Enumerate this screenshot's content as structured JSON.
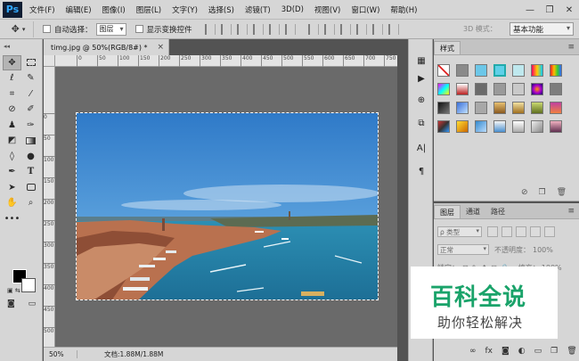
{
  "app": {
    "logo": "Ps"
  },
  "menu": [
    "文件(F)",
    "编辑(E)",
    "图像(I)",
    "图层(L)",
    "文字(Y)",
    "选择(S)",
    "滤镜(T)",
    "3D(D)",
    "视图(V)",
    "窗口(W)",
    "帮助(H)"
  ],
  "window_controls": {
    "minimize": "—",
    "restore": "❐",
    "close": "✕"
  },
  "options": {
    "tool_icon": "move-icon",
    "auto_select_label": "自动选择：",
    "auto_select_value": "图层",
    "show_transform_label": "显示变换控件",
    "mode_3d_label": "3D 模式：",
    "workspace": "基本功能"
  },
  "document": {
    "tab_title": "timg.jpg @ 50%(RGB/8#) *",
    "tab_close": "×",
    "zoom": "50%",
    "doc_info": "文档:1.88M/1.88M",
    "ruler_labels": [
      "0",
      "50",
      "100",
      "150",
      "200",
      "250",
      "300",
      "350",
      "400",
      "450",
      "500",
      "550",
      "600",
      "650",
      "700",
      "750",
      "800"
    ],
    "ruler_v_labels": [
      "0",
      "50",
      "100",
      "150",
      "200",
      "250",
      "300",
      "350",
      "400",
      "450",
      "500"
    ]
  },
  "styles_panel": {
    "tab": "样式",
    "menu": "≡"
  },
  "layers_panel": {
    "tabs": [
      "图层",
      "通道",
      "路径"
    ],
    "kind_label": "ρ 类型",
    "blend_mode": "正常",
    "opacity_label": "不透明度：",
    "opacity_value": "100%",
    "lock_label": "锁定：",
    "fill_label": "填充：",
    "fill_value": "100%"
  },
  "watermark": {
    "title": "百科全说",
    "subtitle": "助你轻松解决"
  }
}
